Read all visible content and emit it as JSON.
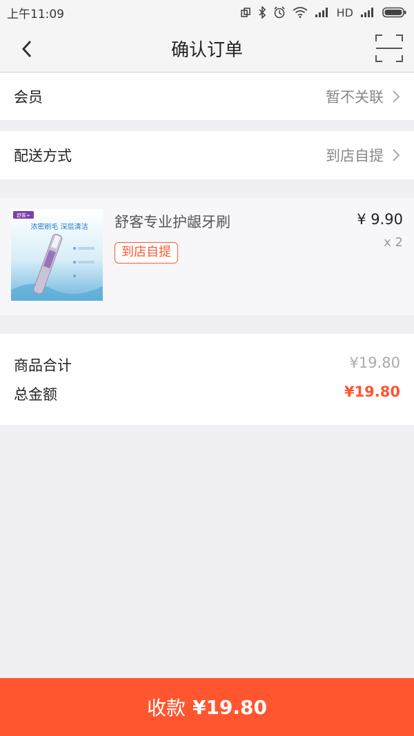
{
  "status_bar": {
    "time": "上午11:09",
    "network": "HD"
  },
  "nav": {
    "title": "确认订单"
  },
  "member": {
    "label": "会员",
    "value": "暂不关联"
  },
  "delivery": {
    "label": "配送方式",
    "value": "到店自提"
  },
  "product": {
    "name": "舒客专业护龈牙刷",
    "tag": "到店自提",
    "price": "¥ 9.90",
    "quantity": "x 2",
    "image_texts": {
      "brand": "舒客+",
      "headline": "浓密刷毛 深层清洁"
    }
  },
  "totals": {
    "subtotal_label": "商品合计",
    "subtotal_value": "¥19.80",
    "total_label": "总金额",
    "total_value": "¥19.80"
  },
  "pay_button": {
    "label": "收款",
    "amount": "¥19.80"
  },
  "colors": {
    "accent": "#ff5630",
    "background": "#efeff4"
  }
}
